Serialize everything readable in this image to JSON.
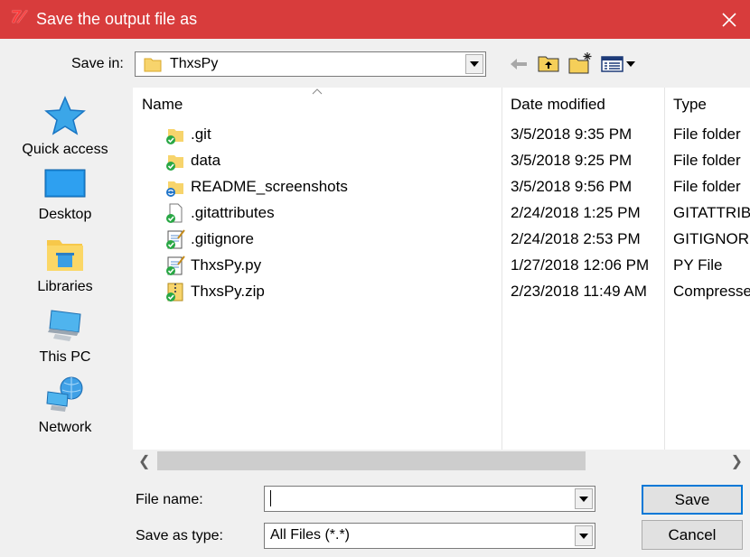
{
  "window": {
    "title": "Save the output file as",
    "app_icon_text": "7⁄"
  },
  "save_in": {
    "label": "Save in:",
    "value": "ThxsPy"
  },
  "places": [
    {
      "label": "Quick access",
      "icon": "star-icon"
    },
    {
      "label": "Desktop",
      "icon": "desktop-icon"
    },
    {
      "label": "Libraries",
      "icon": "libraries-icon"
    },
    {
      "label": "This PC",
      "icon": "computer-icon"
    },
    {
      "label": "Network",
      "icon": "network-icon"
    }
  ],
  "columns": {
    "name": "Name",
    "date": "Date modified",
    "type": "Type"
  },
  "files": [
    {
      "name": ".git",
      "date": "3/5/2018 9:35 PM",
      "type": "File folder",
      "icon": "folder-synced-icon"
    },
    {
      "name": "data",
      "date": "3/5/2018 9:25 PM",
      "type": "File folder",
      "icon": "folder-synced-icon"
    },
    {
      "name": "README_screenshots",
      "date": "3/5/2018 9:56 PM",
      "type": "File folder",
      "icon": "folder-syncing-icon"
    },
    {
      "name": ".gitattributes",
      "date": "2/24/2018 1:25 PM",
      "type": "GITATTRIBUTES",
      "icon": "file-synced-icon"
    },
    {
      "name": ".gitignore",
      "date": "2/24/2018 2:53 PM",
      "type": "GITIGNORE",
      "icon": "notepad-synced-icon"
    },
    {
      "name": "ThxsPy.py",
      "date": "1/27/2018 12:06 PM",
      "type": "PY File",
      "icon": "notepad-synced-icon"
    },
    {
      "name": "ThxsPy.zip",
      "date": "2/23/2018 11:49 AM",
      "type": "Compressed",
      "icon": "zip-synced-icon"
    }
  ],
  "file_name": {
    "label": "File name:",
    "value": ""
  },
  "save_as_type": {
    "label": "Save as type:",
    "value": "All Files (*.*)"
  },
  "buttons": {
    "save": "Save",
    "cancel": "Cancel"
  },
  "colors": {
    "titlebar": "#d83c3c",
    "accent": "#0078d7"
  }
}
